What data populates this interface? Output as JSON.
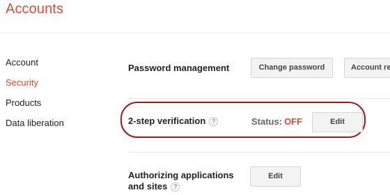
{
  "header": {
    "title": "Accounts"
  },
  "sidebar": {
    "items": [
      {
        "label": "Account",
        "active": false
      },
      {
        "label": "Security",
        "active": true
      },
      {
        "label": "Products",
        "active": false
      },
      {
        "label": "Data liberation",
        "active": false
      }
    ]
  },
  "sections": {
    "password": {
      "title": "Password management",
      "change_button": "Change password",
      "recovery_button": "Account recovery options"
    },
    "two_step": {
      "title": "2-step verification",
      "help": "?",
      "status_label": "Status:",
      "status_value": "OFF",
      "edit_button": "Edit"
    },
    "authorizing": {
      "title_line1": "Authorizing applications",
      "title_line2": "and sites",
      "help": "?",
      "edit_button": "Edit"
    }
  },
  "colors": {
    "accent": "#dd4b39",
    "highlight_ring": "#9e1b22"
  }
}
